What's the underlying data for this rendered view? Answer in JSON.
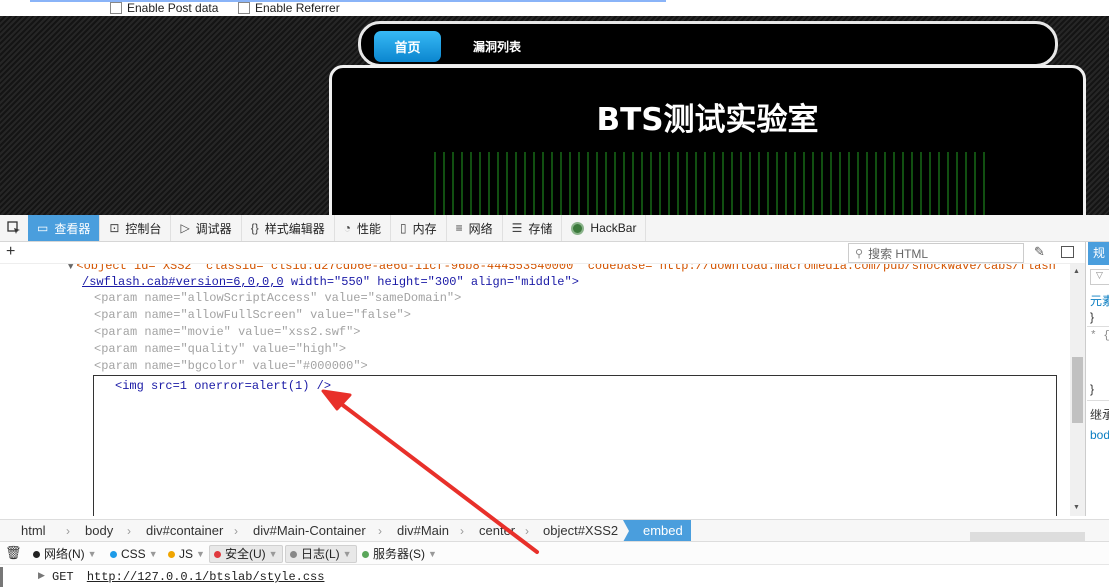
{
  "hackbar": {
    "enable_post": "Enable Post data",
    "enable_referrer": "Enable Referrer"
  },
  "site": {
    "nav_home": "首页",
    "nav_vuln_list": "漏洞列表",
    "title": "BTS测试实验室"
  },
  "devtools": {
    "tabs": [
      {
        "icon": "inspector-icon",
        "label": "查看器",
        "active": true
      },
      {
        "icon": "console-icon",
        "label": "控制台"
      },
      {
        "icon": "debugger-icon",
        "label": "调试器"
      },
      {
        "icon": "style-editor-icon",
        "label": "样式编辑器"
      },
      {
        "icon": "performance-icon",
        "label": "性能"
      },
      {
        "icon": "memory-icon",
        "label": "内存"
      },
      {
        "icon": "network-icon",
        "label": "网络"
      },
      {
        "icon": "storage-icon",
        "label": "存储"
      },
      {
        "icon": "hackbar-icon",
        "label": "HackBar"
      }
    ],
    "search_placeholder": "搜索 HTML",
    "accent": "#4a9edd"
  },
  "markup": {
    "object_line_1": "<object id=\"XSS2\" classid=\"clsid:d27cdb6e-ae6d-11cf-96b8-444553540000\" codebase=\"http://download.macromedia.com/pub/shockwave/cabs/flash",
    "object_line_2_url": "/swflash.cab#version=6,0,0,0",
    "object_line_2_rest": " width=\"550\" height=\"300\" align=\"middle\">",
    "params": [
      {
        "name": "allowScriptAccess",
        "value": "sameDomain"
      },
      {
        "name": "allowFullScreen",
        "value": "false"
      },
      {
        "name": "movie",
        "value": "xss2.swf"
      },
      {
        "name": "quality",
        "value": "high"
      },
      {
        "name": "bgcolor",
        "value": "#000000"
      }
    ],
    "edited_html": "<img src=1 onerror=alert(1) />"
  },
  "rules_pane": {
    "elements_label": "元素",
    "brace_close": "}",
    "star": "* {",
    "inherited": "继承",
    "body_sel": "bod"
  },
  "breadcrumbs": [
    "html",
    "body",
    "div#container",
    "div#Main-Container",
    "div#Main",
    "center",
    "object#XSS2",
    "embed"
  ],
  "console": {
    "filters": [
      {
        "label": "网络(N)",
        "color": "#222222"
      },
      {
        "label": "CSS",
        "color": "#1e9be8"
      },
      {
        "label": "JS",
        "color": "#f0a500"
      },
      {
        "label": "安全(U)",
        "color": "#e0393e"
      },
      {
        "label": "日志(L)",
        "color": "#888888"
      },
      {
        "label": "服务器(S)",
        "color": "#5aa65a"
      }
    ],
    "method": "GET",
    "url": "http://127.0.0.1/btslab/style.css"
  }
}
